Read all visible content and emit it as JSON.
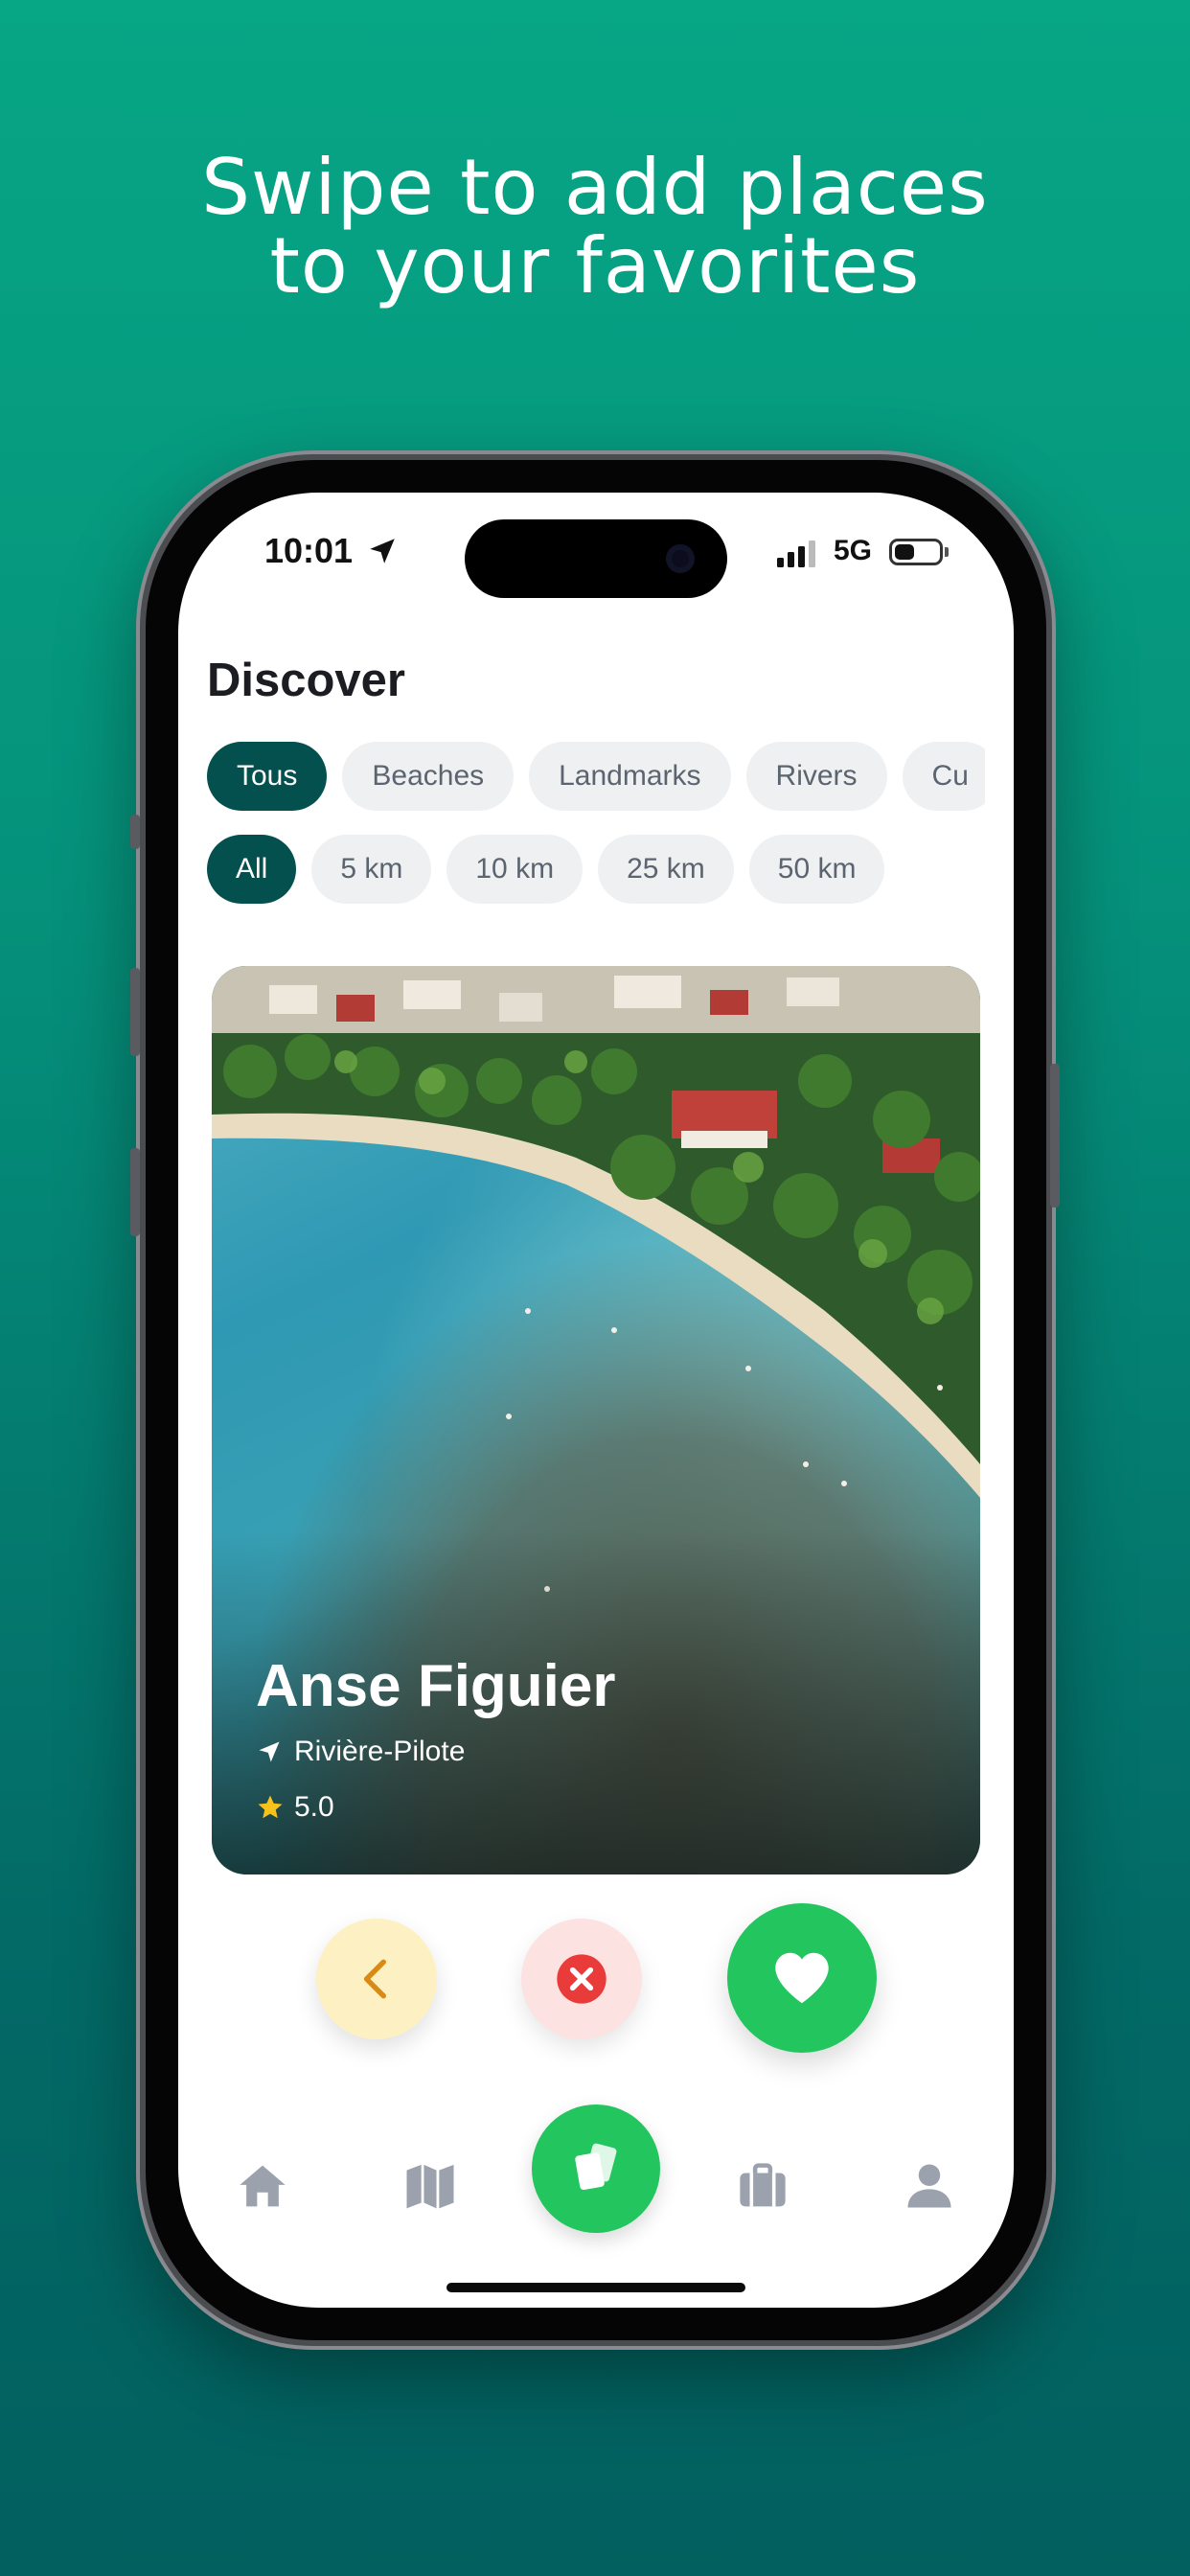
{
  "headline": {
    "line1": "Swipe to add places",
    "line2": "to your favorites"
  },
  "status_bar": {
    "time": "10:01",
    "network": "5G",
    "battery_level": 0.45
  },
  "page": {
    "title": "Discover"
  },
  "category_filters": [
    {
      "label": "Tous",
      "active": true
    },
    {
      "label": "Beaches",
      "active": false
    },
    {
      "label": "Landmarks",
      "active": false
    },
    {
      "label": "Rivers",
      "active": false
    },
    {
      "label": "Cu",
      "active": false
    }
  ],
  "distance_filters": [
    {
      "label": "All",
      "active": true
    },
    {
      "label": "5 km",
      "active": false
    },
    {
      "label": "10 km",
      "active": false
    },
    {
      "label": "25 km",
      "active": false
    },
    {
      "label": "50 km",
      "active": false
    }
  ],
  "card": {
    "name": "Anse Figuier",
    "location": "Rivière-Pilote",
    "rating": "5.0"
  },
  "actions": {
    "back_icon": "chevron-left-icon",
    "dismiss_icon": "close-icon",
    "like_icon": "heart-icon"
  },
  "bottom_nav": [
    {
      "icon": "home-icon"
    },
    {
      "icon": "map-icon"
    },
    {
      "icon": "cards-icon",
      "center": true
    },
    {
      "icon": "briefcase-icon"
    },
    {
      "icon": "user-icon"
    }
  ],
  "colors": {
    "background_top": "#07a685",
    "background_bottom": "#02605f",
    "chip_active": "#03504e",
    "chip_inactive": "#eef0f2",
    "like_green": "#22c55e",
    "back_yellow": "#fdf1c4",
    "dismiss_pink": "#fde2e2",
    "dismiss_red": "#ea3b3b",
    "back_orange": "#d98a14",
    "star_yellow": "#f7c31a",
    "nav_icon_gray": "#9ba2ad"
  }
}
